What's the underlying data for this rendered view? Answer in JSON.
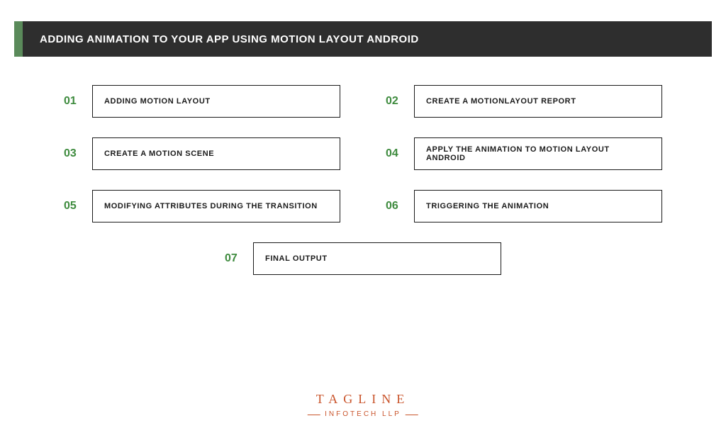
{
  "header": {
    "title": "ADDING ANIMATION TO YOUR APP USING MOTION LAYOUT ANDROID"
  },
  "steps": [
    {
      "num": "01",
      "label": "ADDING MOTION LAYOUT"
    },
    {
      "num": "02",
      "label": "CREATE A MOTIONLAYOUT REPORT"
    },
    {
      "num": "03",
      "label": "CREATE A MOTION SCENE"
    },
    {
      "num": "04",
      "label": "APPLY THE ANIMATION TO MOTION LAYOUT ANDROID"
    },
    {
      "num": "05",
      "label": "MODIFYING ATTRIBUTES DURING THE TRANSITION"
    },
    {
      "num": "06",
      "label": "TRIGGERING THE ANIMATION"
    },
    {
      "num": "07",
      "label": "FINAL OUTPUT"
    }
  ],
  "footer": {
    "logo_main": "TAGLINE",
    "logo_sub": "INFOTECH LLP"
  }
}
